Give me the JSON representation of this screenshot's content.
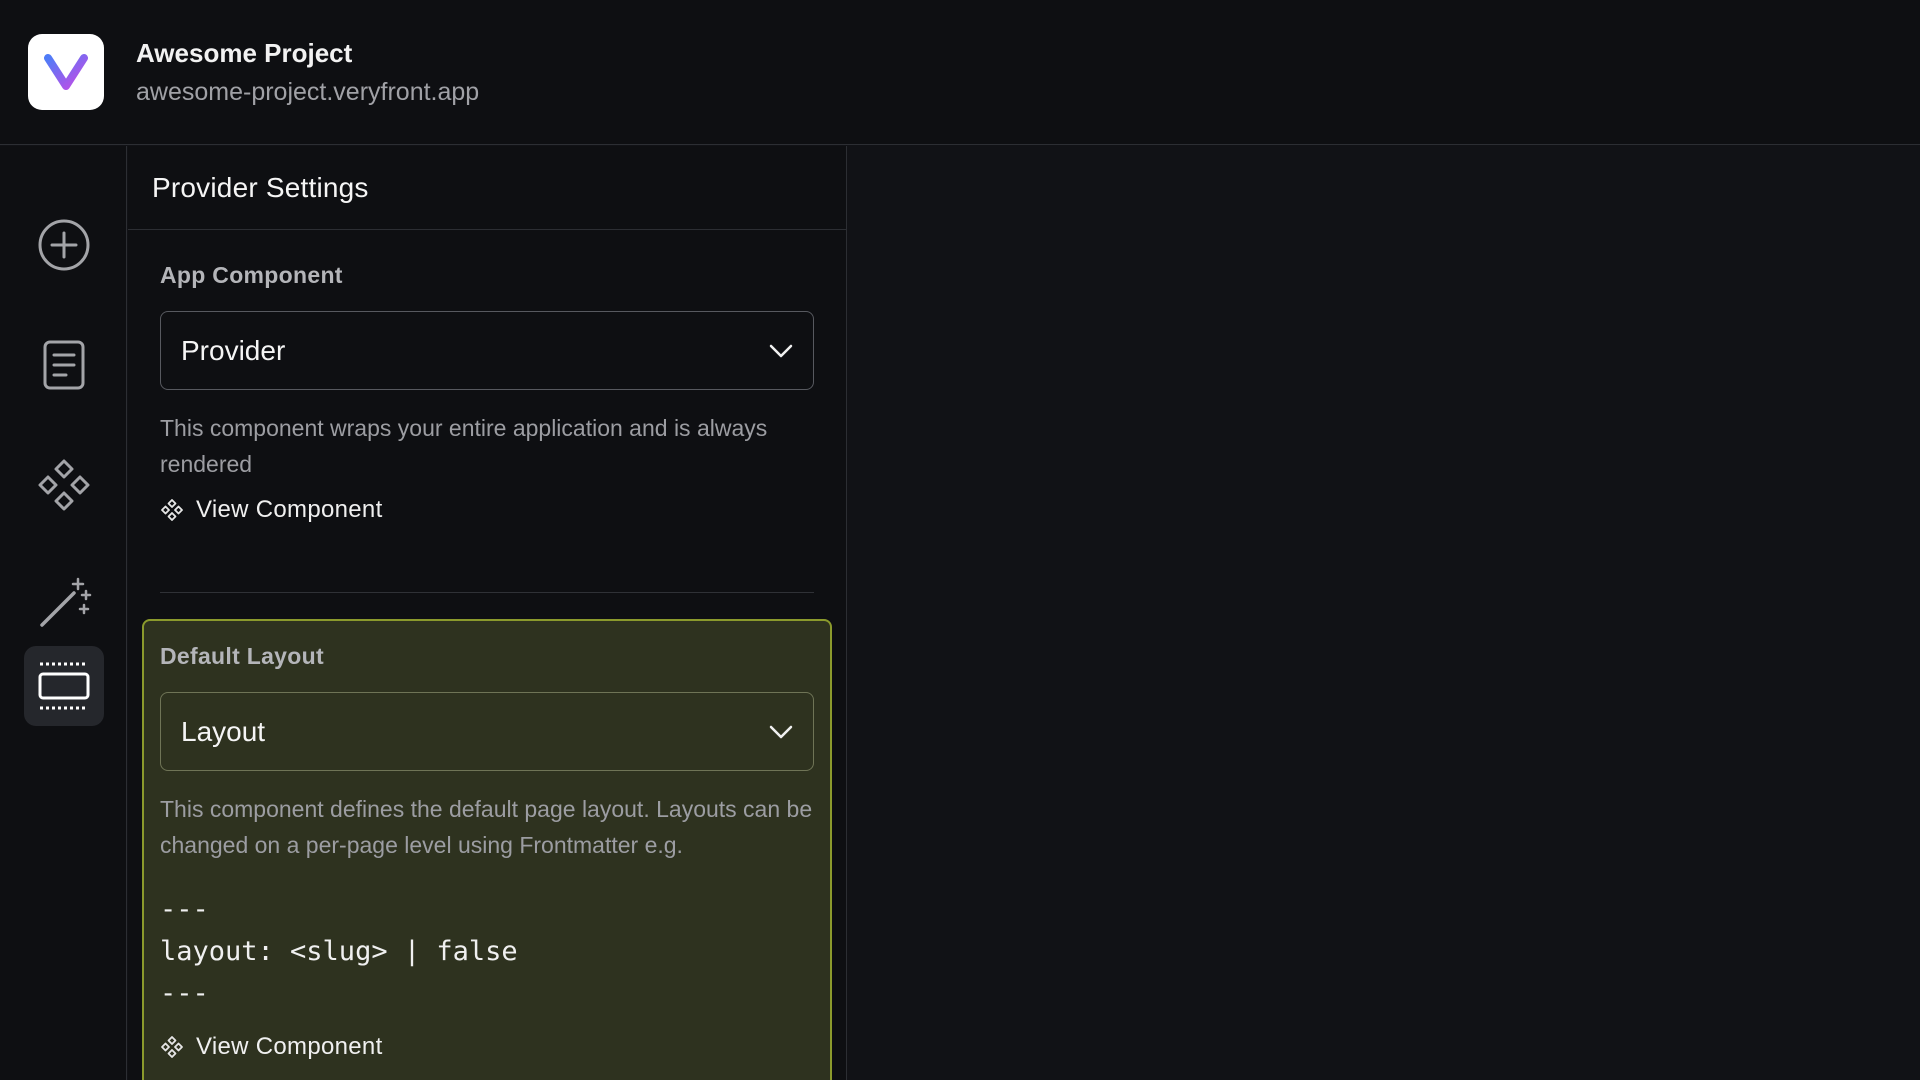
{
  "header": {
    "project_title": "Awesome Project",
    "project_url": "awesome-project.veryfront.app"
  },
  "rail": {
    "items": [
      {
        "icon": "add-circle-icon",
        "active": false
      },
      {
        "icon": "document-icon",
        "active": false
      },
      {
        "icon": "components-icon",
        "active": false
      },
      {
        "icon": "magic-wand-icon",
        "active": false
      },
      {
        "icon": "layout-icon",
        "active": true
      }
    ]
  },
  "panel": {
    "title": "Provider Settings",
    "app_component": {
      "label": "App Component",
      "selected": "Provider",
      "description": "This component wraps your entire application and is always rendered",
      "link": "View Component"
    },
    "default_layout": {
      "label": "Default Layout",
      "selected": "Layout",
      "description": "This component defines the default page layout. Layouts can be changed on a per-page level using Frontmatter e.g.",
      "code": "---\nlayout: <slug> | false\n---",
      "link": "View Component"
    }
  },
  "colors": {
    "background": "#111216",
    "highlight_bg": "#2e321f",
    "highlight_border": "#8b9a2c",
    "logo_gradient": [
      "#5b6cf5",
      "#c24be8"
    ]
  }
}
